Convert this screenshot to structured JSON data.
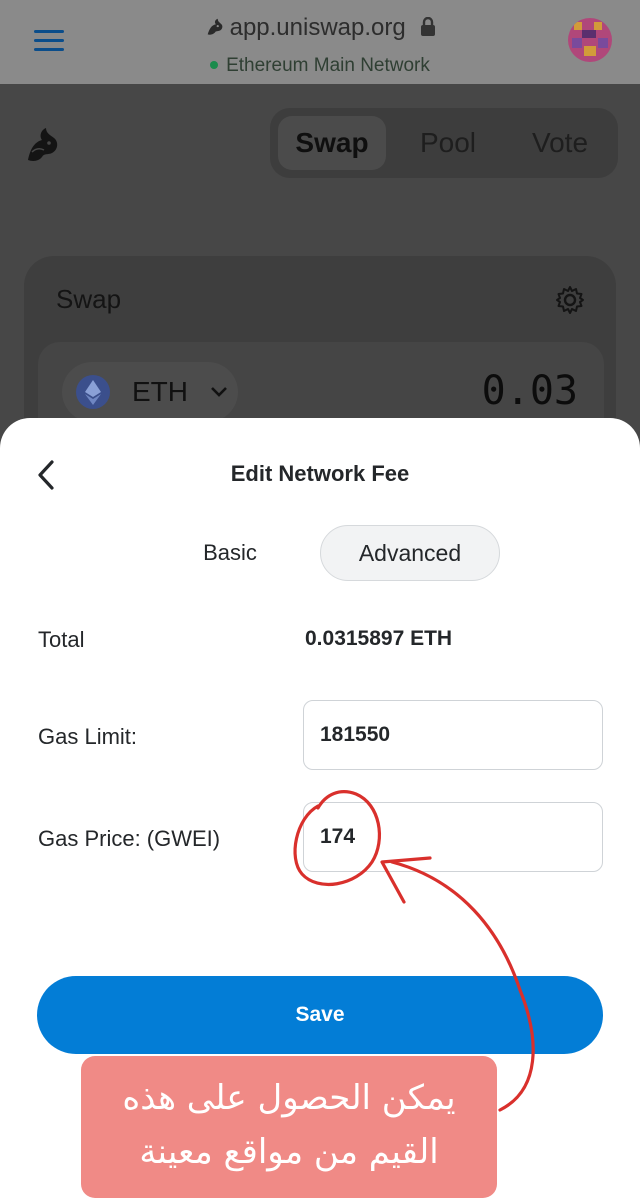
{
  "browser": {
    "url": "app.uniswap.org",
    "network": "Ethereum Main Network",
    "accent_color": "#0b4d8a",
    "network_dot_color": "#1a8b4c"
  },
  "dapp": {
    "tabs": [
      {
        "label": "Swap",
        "active": true
      },
      {
        "label": "Pool",
        "active": false
      },
      {
        "label": "Vote",
        "active": false
      }
    ],
    "card_title": "Swap",
    "token": "ETH",
    "amount": "0.03"
  },
  "sheet": {
    "title": "Edit Network Fee",
    "segments": {
      "basic": "Basic",
      "advanced": "Advanced",
      "selected": "Advanced"
    },
    "total_label": "Total",
    "total_value": "0.0315897 ETH",
    "gas_limit_label": "Gas Limit:",
    "gas_limit_value": "181550",
    "gas_price_label": "Gas Price: (GWEI)",
    "gas_price_value": "174",
    "save_label": "Save",
    "save_color": "#037dd6"
  },
  "annotation": {
    "line1": "يمكن الحصول على هذه",
    "line2": "القيم من مواقع معينة",
    "mark_color": "#d9302c",
    "box_color": "#f08a86"
  }
}
